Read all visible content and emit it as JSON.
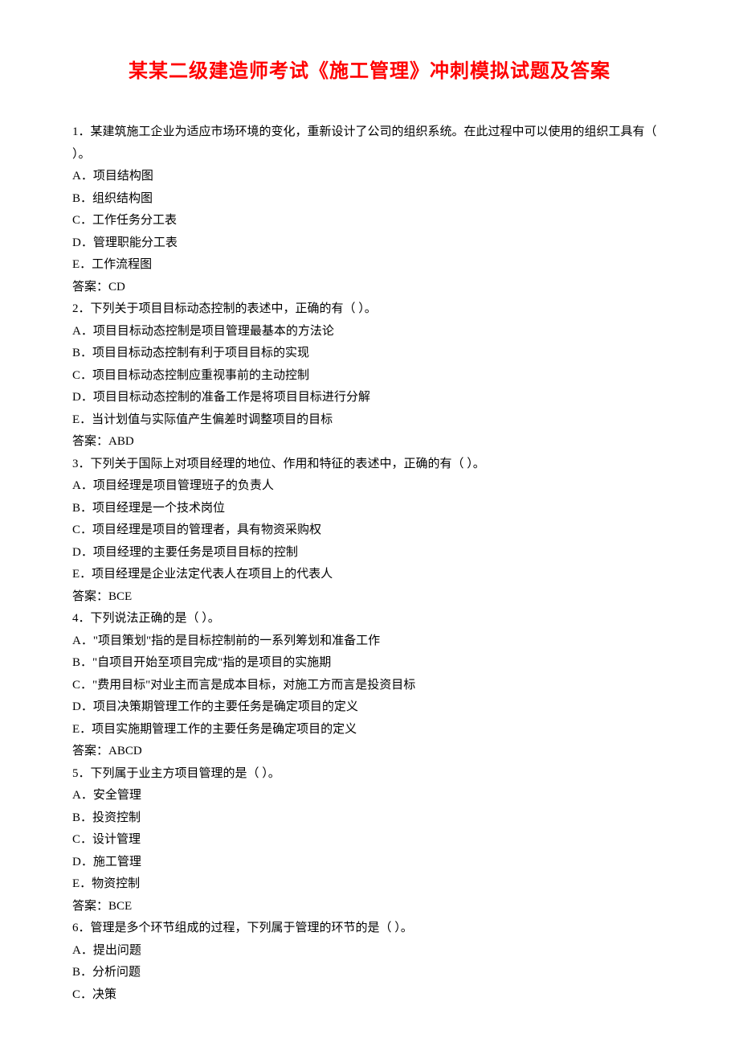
{
  "title": "某某二级建造师考试《施工管理》冲刺模拟试题及答案",
  "answer_prefix": "答案：",
  "questions": [
    {
      "stem": "1．某建筑施工企业为适应市场环境的变化，重新设计了公司的组织系统。在此过程中可以使用的组织工具有（ ）。",
      "options": [
        "A．项目结构图",
        "B．组织结构图",
        "C．工作任务分工表",
        "D．管理职能分工表",
        "E．工作流程图"
      ],
      "answer": "CD"
    },
    {
      "stem": "2．下列关于项目目标动态控制的表述中，正确的有（ ）。",
      "options": [
        "A．项目目标动态控制是项目管理最基本的方法论",
        "B．项目目标动态控制有利于项目目标的实现",
        "C．项目目标动态控制应重视事前的主动控制",
        "D．项目目标动态控制的准备工作是将项目目标进行分解",
        "E．当计划值与实际值产生偏差时调整项目的目标"
      ],
      "answer": "ABD"
    },
    {
      "stem": "3．下列关于国际上对项目经理的地位、作用和特征的表述中，正确的有（ ）。",
      "options": [
        "A．项目经理是项目管理班子的负责人",
        "B．项目经理是一个技术岗位",
        "C．项目经理是项目的管理者，具有物资采购权",
        "D．项目经理的主要任务是项目目标的控制",
        "E．项目经理是企业法定代表人在项目上的代表人"
      ],
      "answer": "BCE"
    },
    {
      "stem": "4．下列说法正确的是（ ）。",
      "options": [
        "A．\"项目策划\"指的是目标控制前的一系列筹划和准备工作",
        "B．\"自项目开始至项目完成\"指的是项目的实施期",
        "C．\"费用目标\"对业主而言是成本目标，对施工方而言是投资目标",
        "D．项目决策期管理工作的主要任务是确定项目的定义",
        "E．项目实施期管理工作的主要任务是确定项目的定义"
      ],
      "answer": "ABCD"
    },
    {
      "stem": "5．下列属于业主方项目管理的是（ ）。",
      "options": [
        "A．安全管理",
        "B．投资控制",
        "C．设计管理",
        "D．施工管理",
        "E．物资控制"
      ],
      "answer": "BCE"
    },
    {
      "stem": "6．管理是多个环节组成的过程，下列属于管理的环节的是（ ）。",
      "options": [
        "A．提出问题",
        "B．分析问题",
        "C．决策"
      ],
      "answer": null
    }
  ]
}
